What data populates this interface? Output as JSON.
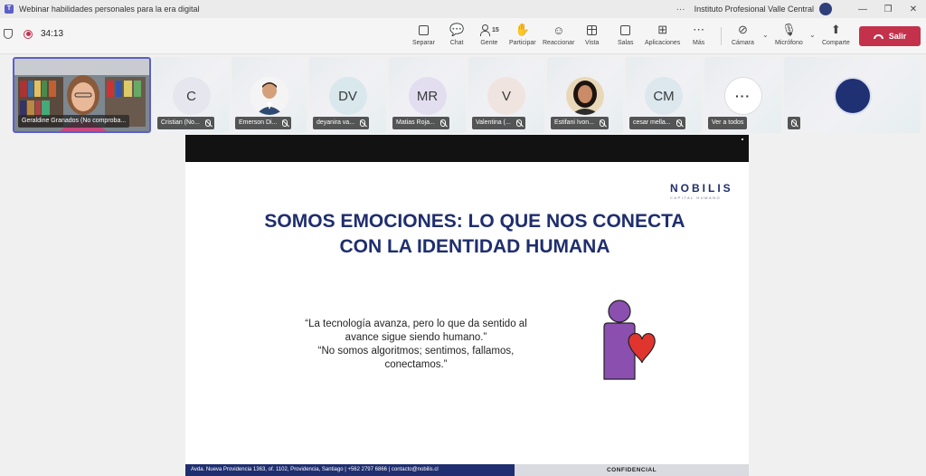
{
  "window": {
    "title": "Webinar habilidades personales para la era digital",
    "org": "Instituto Profesional Valle Central",
    "more_dots": "···",
    "min": "—",
    "restore": "❐",
    "close": "✕"
  },
  "toolbar": {
    "timer": "34:13",
    "buttons": {
      "separar": "Separar",
      "chat": "Chat",
      "gente": "Gente",
      "gente_count": "15",
      "participar": "Participar",
      "reaccionar": "Reaccionar",
      "vista": "Vista",
      "salas": "Salas",
      "aplicaciones": "Aplicaciones",
      "mas": "Más",
      "camara": "Cámara",
      "microfono": "Micrófono",
      "comparte": "Comparte",
      "salir": "Salir"
    }
  },
  "participants": [
    {
      "name": "Geraldine Granados (No comproba...",
      "type": "video"
    },
    {
      "name": "Cristian (No...",
      "initials": "C",
      "bg": "#e6e7ee"
    },
    {
      "name": "Emerson Di...",
      "type": "photo"
    },
    {
      "name": "deyanira va...",
      "initials": "DV",
      "bg": "#d9e8ec"
    },
    {
      "name": "Matias Roja...",
      "initials": "MR",
      "bg": "#e2def0"
    },
    {
      "name": "Valentina (...",
      "initials": "V",
      "bg": "#f0e4e0"
    },
    {
      "name": "Estifani Ivon...",
      "type": "photo2"
    },
    {
      "name": "cesar mella...",
      "initials": "CM",
      "bg": "#dce8ee"
    },
    {
      "name": "Ver a todos",
      "type": "more",
      "more": "···"
    },
    {
      "name": "",
      "type": "logo"
    }
  ],
  "slide": {
    "brand_name": "NOBILIS",
    "brand_sub": "CAPITAL HUMANO",
    "title_line1": "SOMOS EMOCIONES: LO QUE NOS CONECTA",
    "title_line2": "CON LA IDENTIDAD HUMANA",
    "quote_line1": "“La tecnología avanza, pero lo que da sentido al",
    "quote_line2": "avance sigue siendo humano.”",
    "quote_line3": "“No somos algoritmos; sentimos, fallamos,",
    "quote_line4": "conectamos.”",
    "footer_left": "Avda. Nueva Providencia 1363, of. 1102, Providencia, Santiago  |  +562 2797 6866  |  contacto@nobilis.cl",
    "footer_right": "CONFIDENCIAL"
  },
  "colors": {
    "accent": "#5b5fc7",
    "leave": "#c4314b",
    "brand_navy": "#1f2e6e",
    "figure_purple": "#8b4fb0",
    "heart_red": "#e0352f"
  }
}
